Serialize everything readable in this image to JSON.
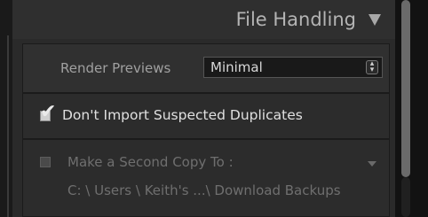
{
  "header": {
    "title": "File Handling",
    "collapse_icon": "triangle-down-icon"
  },
  "render_previews": {
    "label": "Render Previews",
    "value": "Minimal",
    "select_icon": "updown-arrows-icon"
  },
  "duplicates": {
    "label": "Don't Import Suspected Duplicates",
    "checked": true
  },
  "second_copy": {
    "label": "Make a Second Copy To :",
    "checked": false,
    "enabled": false,
    "path": "C: \\ Users \\ Keith's ...\\ Download Backups"
  },
  "colors": {
    "panel_bg": "#2a2a2a",
    "text_dim": "#6f6f6f",
    "text_main": "#e0e0e0"
  }
}
